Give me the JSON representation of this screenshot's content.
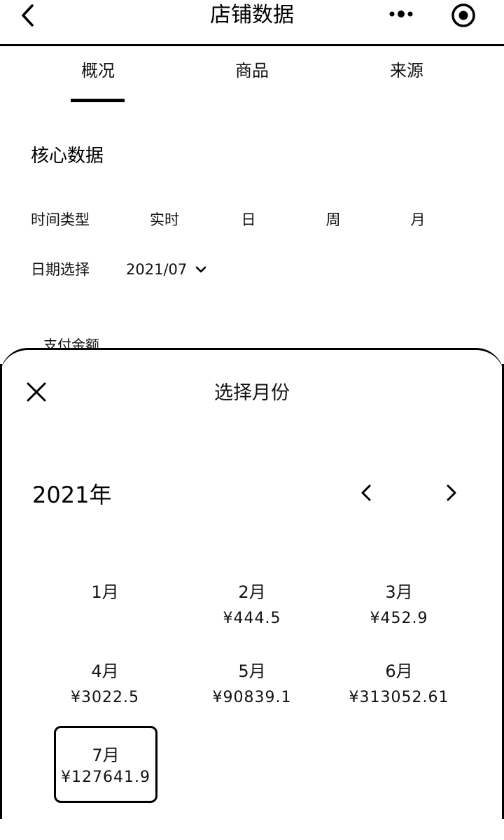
{
  "header": {
    "title": "店铺数据",
    "icons": {
      "back": "chevron-left-icon",
      "more": "more-dots-icon",
      "target": "record-target-icon"
    }
  },
  "tabs": [
    {
      "label": "概况",
      "active": true
    },
    {
      "label": "商品",
      "active": false
    },
    {
      "label": "来源",
      "active": false
    }
  ],
  "core": {
    "title": "核心数据",
    "time_type_label": "时间类型",
    "time_options": [
      "实时",
      "日",
      "周",
      "月"
    ],
    "date_label": "日期选择",
    "date_value": "2021/07",
    "partial_label": "支付金额"
  },
  "picker": {
    "title": "选择月份",
    "year": "2021年",
    "months": [
      {
        "label": "1月",
        "amount": ""
      },
      {
        "label": "2月",
        "amount": "¥444.5"
      },
      {
        "label": "3月",
        "amount": "¥452.9"
      },
      {
        "label": "4月",
        "amount": "¥3022.5"
      },
      {
        "label": "5月",
        "amount": "¥90839.1"
      },
      {
        "label": "6月",
        "amount": "¥313052.61"
      },
      {
        "label": "7月",
        "amount": "¥127641.9",
        "selected": true
      }
    ]
  }
}
